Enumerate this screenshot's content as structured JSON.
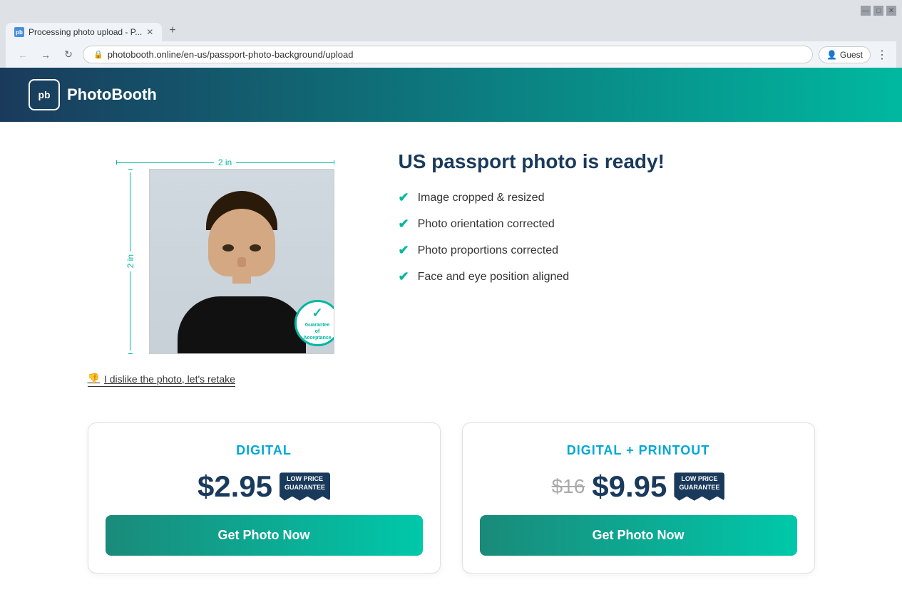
{
  "browser": {
    "tab_title": "Processing photo upload - P...",
    "url": "photobooth.online/en-us/passport-photo-background/upload",
    "favicon_text": "pb",
    "guest_label": "Guest"
  },
  "header": {
    "logo_text": "pb",
    "brand_name": "PhotoBooth"
  },
  "photo": {
    "width_label": "2 in",
    "height_label": "2 in",
    "guarantee_line1": "Guarantee",
    "guarantee_line2": "of",
    "guarantee_line3": "Acceptance",
    "retake_label": "I dislike the photo, let's retake"
  },
  "info": {
    "title": "US passport photo is ready!",
    "features": [
      "Image cropped & resized",
      "Photo orientation corrected",
      "Photo proportions corrected",
      "Face and eye position aligned"
    ]
  },
  "pricing": [
    {
      "type": "DIGITAL",
      "price": "$2.95",
      "price_old": null,
      "badge_line1": "LOW PRICE",
      "badge_line2": "GUARANTEE",
      "btn_label": "Get Photo Now"
    },
    {
      "type": "DIGITAL + PRINTOUT",
      "price": "$9.95",
      "price_old": "$16",
      "badge_line1": "LOW PRICE",
      "badge_line2": "GUARANTEE",
      "btn_label": "Get Photo Now"
    }
  ]
}
